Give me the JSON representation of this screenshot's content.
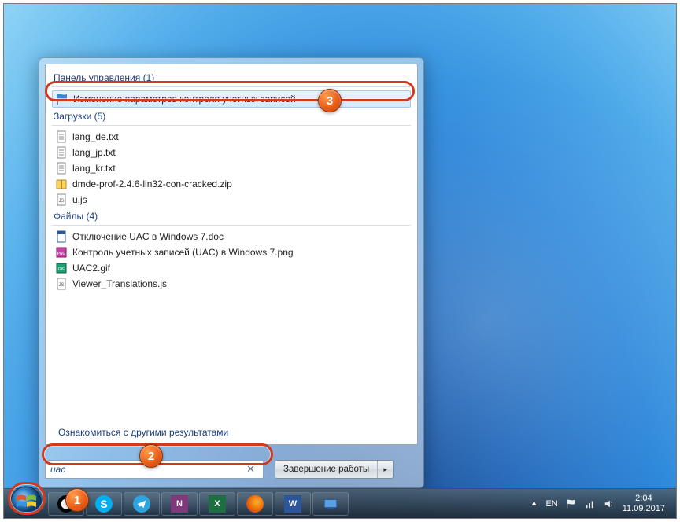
{
  "search": {
    "query": "uac",
    "more_link": "Ознакомиться с другими результатами",
    "shutdown_label": "Завершение работы"
  },
  "groups": [
    {
      "title": "Панель управления (1)",
      "items": [
        {
          "icon": "flag-icon",
          "label": "Изменение параметров контроля учетных записей",
          "selected": true
        }
      ]
    },
    {
      "title": "Загрузки (5)",
      "items": [
        {
          "icon": "txt-icon",
          "label": "lang_de.txt"
        },
        {
          "icon": "txt-icon",
          "label": "lang_jp.txt"
        },
        {
          "icon": "txt-icon",
          "label": "lang_kr.txt"
        },
        {
          "icon": "zip-icon",
          "label": "dmde-prof-2.4.6-lin32-con-cracked.zip"
        },
        {
          "icon": "js-icon",
          "label": "u.js"
        }
      ]
    },
    {
      "title": "Файлы (4)",
      "items": [
        {
          "icon": "doc-icon",
          "label": "Отключение UAC в Windows 7.doc"
        },
        {
          "icon": "png-icon",
          "label": "Контроль учетных записей (UAC) в Windows 7.png"
        },
        {
          "icon": "gif-icon",
          "label": "UAC2.gif"
        },
        {
          "icon": "js-icon",
          "label": "Viewer_Translations.js"
        }
      ]
    }
  ],
  "tray": {
    "lang": "EN",
    "time": "2:04",
    "date": "11.09.2017"
  },
  "taskbar_icons": [
    "soccer",
    "skype",
    "telegram",
    "onenote",
    "excel",
    "firefox",
    "word",
    "action-center"
  ]
}
